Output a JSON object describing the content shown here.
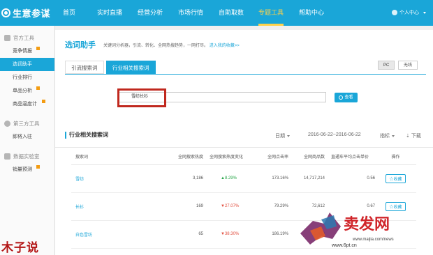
{
  "nav": {
    "brand": "生意参谋",
    "items": [
      "首页",
      "实时直播",
      "经营分析",
      "市场行情",
      "自助取数",
      "专题工具",
      "帮助中心"
    ],
    "active_index": 5,
    "user": "个人中心"
  },
  "sidebar": {
    "sections": [
      {
        "title": "官方工具",
        "items": [
          "竞争情报",
          "选词助手",
          "行业排行",
          "单品分析",
          "商品温度计"
        ]
      },
      {
        "title": "第三方工具",
        "items": [
          "即将入驻"
        ]
      },
      {
        "title": "数据实验室",
        "items": [
          "销量预测"
        ]
      }
    ],
    "active_item": "选词助手"
  },
  "page": {
    "title": "选词助手",
    "desc": "关键词分析器，引流、转化、全网热搜趋势，一网打尽。",
    "desc_link": "进入我的收藏>>",
    "tabs": [
      "引流搜索词",
      "行业相关搜索词"
    ],
    "active_tab": 1,
    "device_pc": "PC",
    "device_wireless": "无线"
  },
  "search": {
    "value": "雪纺长衫",
    "button": "查看"
  },
  "results": {
    "title": "行业相关搜索词",
    "date_label": "日期",
    "date_range": "2016-06-22~2016-06-22",
    "metric_label": "指标",
    "download": "下载",
    "columns": [
      "搜索词",
      "全网搜索热度",
      "全网搜索热度变化",
      "全网点击率",
      "全网商品数",
      "直通车平均点击单价",
      "操作"
    ],
    "rows": [
      {
        "keyword": "雪纺",
        "heat": "3,186",
        "change": "8.29%",
        "dir": "up",
        "ctr": "173.16%",
        "items": "14,717,214",
        "cpc": "0.56",
        "action": "收藏"
      },
      {
        "keyword": "长衫",
        "heat": "169",
        "change": "27.07%",
        "dir": "down",
        "ctr": "79.29%",
        "items": "72,612",
        "cpc": "0.67",
        "action": "收藏"
      },
      {
        "keyword": "白色雪纺",
        "heat": "65",
        "change": "38.30%",
        "dir": "down",
        "ctr": "186.19%",
        "items": "3,490",
        "cpc": "",
        "action": ""
      }
    ]
  },
  "watermark": {
    "left": "木子说",
    "right_logo": "卖发网",
    "url": "www.maijia.com/news",
    "url2": "www.6pt.cn"
  },
  "colors": {
    "accent": "#1aa6d8",
    "highlight_box": "#c0281e",
    "up": "#2aa74b",
    "down": "#e14c3c"
  }
}
